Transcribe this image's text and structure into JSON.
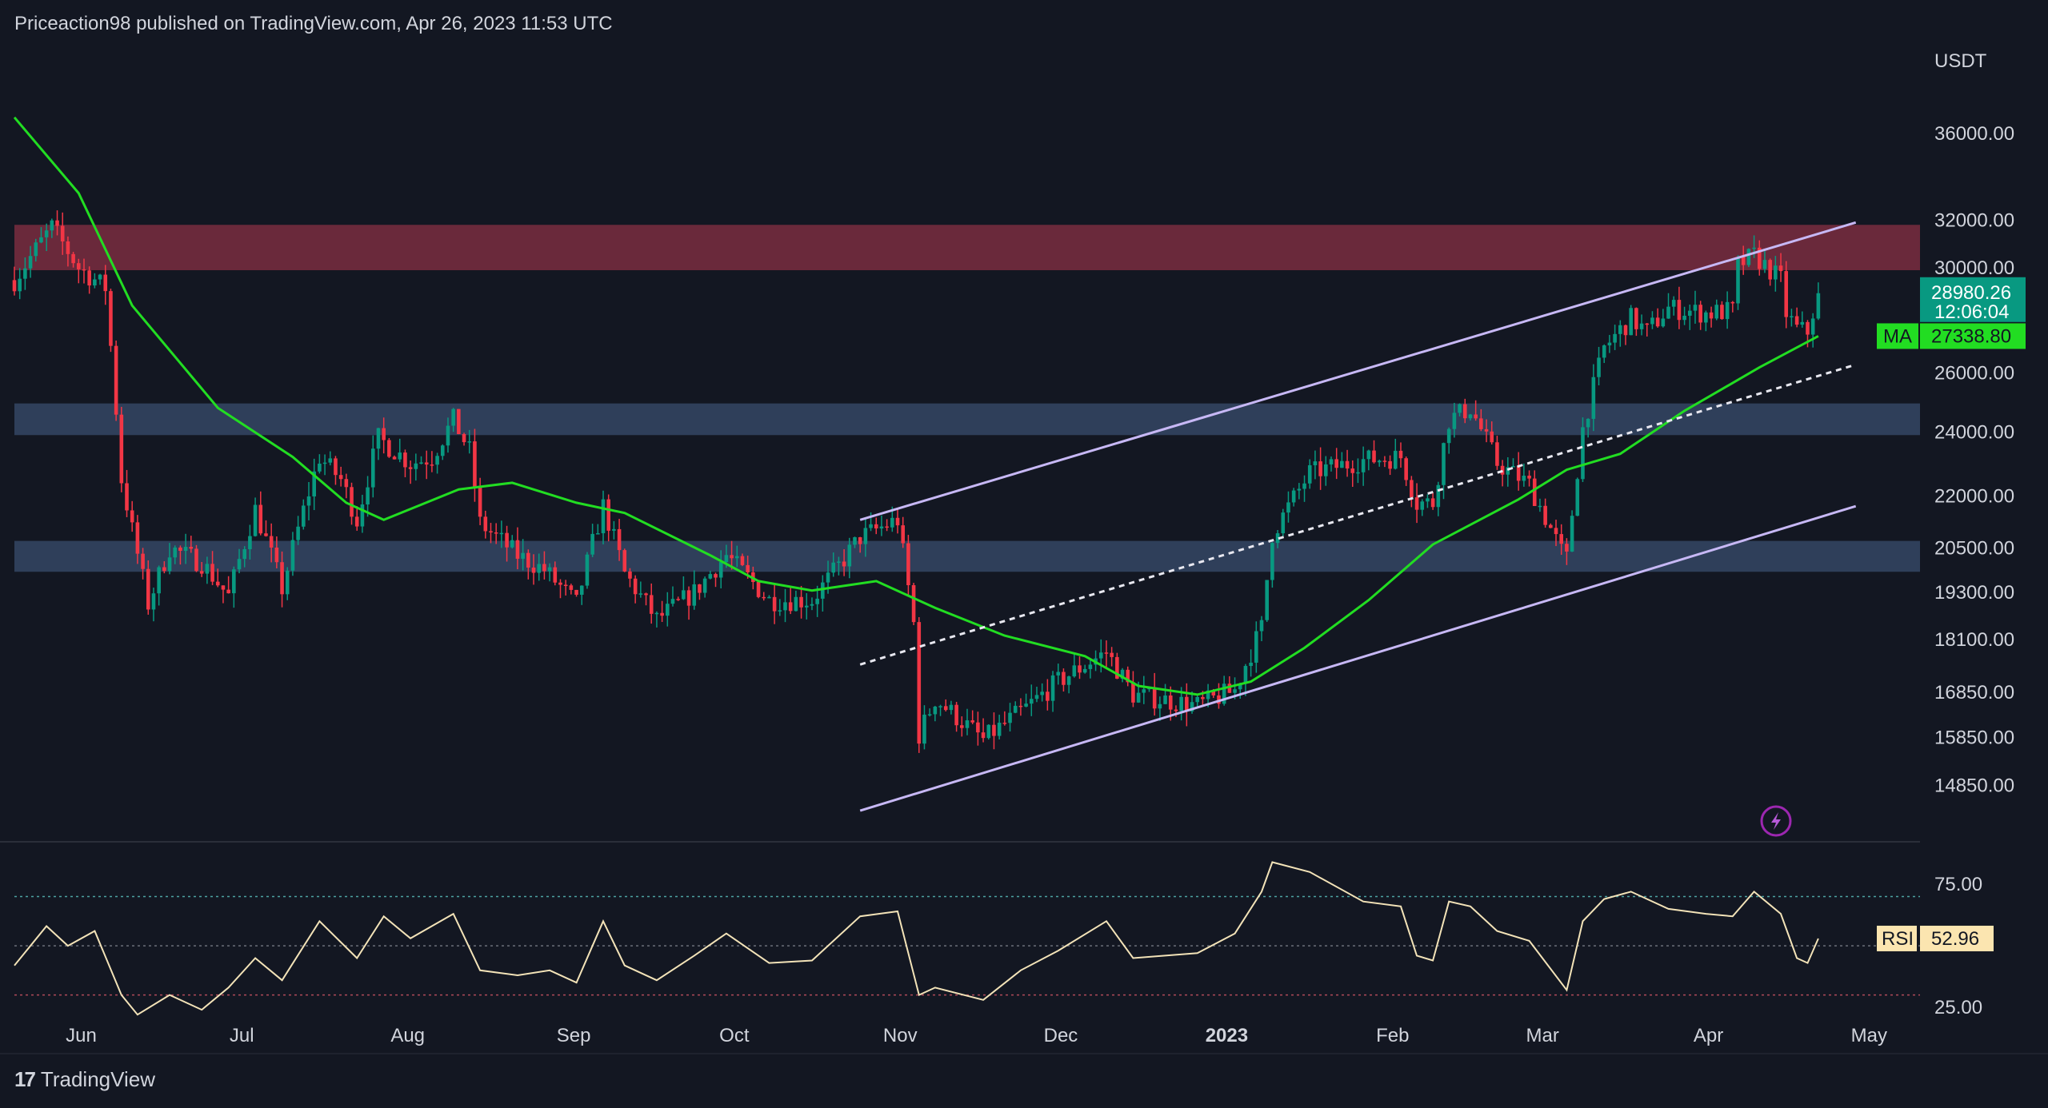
{
  "header": {
    "published_line": "Priceaction98 published on TradingView.com, Apr 26, 2023 11:53 UTC"
  },
  "footer": {
    "brand": "TradingView"
  },
  "colors": {
    "background": "#131722",
    "bull": "#089981",
    "bear": "#f23645",
    "ma": "#22dd22",
    "channel": "#c7b8f5",
    "resistance_zone": "#7a2d40",
    "support_zone": "#3a4e6e",
    "rsi_line": "#f3e3b8",
    "price_tag": "#089981",
    "ma_tag": "#22dd22",
    "rsi_tag": "#fbe5b0"
  },
  "chart_data": [
    {
      "type": "candlestick",
      "currency": "USDT",
      "y_scale": "log",
      "ylim": [
        13800,
        40000
      ],
      "price_ticks": [
        36000,
        32000,
        30000,
        26000,
        24000,
        22000,
        20500,
        19300,
        18100,
        16850,
        15850,
        14850
      ],
      "price_tick_labels": [
        "36000.00",
        "32000.00",
        "30000.00",
        "26000.00",
        "24000.00",
        "22000.00",
        "20500.00",
        "19300.00",
        "18100.00",
        "16850.00",
        "15850.00",
        "14850.00"
      ],
      "x_labels": [
        "Jun",
        "Jul",
        "Aug",
        "Sep",
        "Oct",
        "Nov",
        "Dec",
        "2023",
        "Feb",
        "Mar",
        "Apr",
        "May"
      ],
      "x_label_dates": [
        "2022-06-01",
        "2022-07-01",
        "2022-08-01",
        "2022-09-01",
        "2022-10-01",
        "2022-11-01",
        "2022-12-01",
        "2023-01-01",
        "2023-02-01",
        "2023-03-01",
        "2023-04-01",
        "2023-05-01"
      ],
      "x_range": [
        "2022-05-24",
        "2023-05-15"
      ],
      "last_date": "2023-04-26",
      "price_path": [
        [
          "2022-05-24",
          29500
        ],
        [
          "2022-05-31",
          31700
        ],
        [
          "2022-06-05",
          30000
        ],
        [
          "2022-06-10",
          29200
        ],
        [
          "2022-06-13",
          22500
        ],
        [
          "2022-06-15",
          21000
        ],
        [
          "2022-06-18",
          19000
        ],
        [
          "2022-06-22",
          20500
        ],
        [
          "2022-06-28",
          20100
        ],
        [
          "2022-07-03",
          19200
        ],
        [
          "2022-07-08",
          21600
        ],
        [
          "2022-07-13",
          19400
        ],
        [
          "2022-07-20",
          23200
        ],
        [
          "2022-07-24",
          22500
        ],
        [
          "2022-07-27",
          21300
        ],
        [
          "2022-07-31",
          23800
        ],
        [
          "2022-08-06",
          23000
        ],
        [
          "2022-08-10",
          23200
        ],
        [
          "2022-08-14",
          24400
        ],
        [
          "2022-08-17",
          23400
        ],
        [
          "2022-08-19",
          21200
        ],
        [
          "2022-08-26",
          20300
        ],
        [
          "2022-08-31",
          19900
        ],
        [
          "2022-09-06",
          19000
        ],
        [
          "2022-09-11",
          21700
        ],
        [
          "2022-09-15",
          19800
        ],
        [
          "2022-09-21",
          18600
        ],
        [
          "2022-09-28",
          19300
        ],
        [
          "2022-10-04",
          20300
        ],
        [
          "2022-10-12",
          19100
        ],
        [
          "2022-10-20",
          19100
        ],
        [
          "2022-10-25",
          20000
        ],
        [
          "2022-10-29",
          20800
        ],
        [
          "2022-11-05",
          21300
        ],
        [
          "2022-11-08",
          18500
        ],
        [
          "2022-11-09",
          15900
        ],
        [
          "2022-11-12",
          16700
        ],
        [
          "2022-11-21",
          15800
        ],
        [
          "2022-11-29",
          16500
        ],
        [
          "2022-12-05",
          17100
        ],
        [
          "2022-12-14",
          17800
        ],
        [
          "2022-12-19",
          16800
        ],
        [
          "2022-12-31",
          16550
        ],
        [
          "2023-01-07",
          16900
        ],
        [
          "2023-01-12",
          18400
        ],
        [
          "2023-01-14",
          20900
        ],
        [
          "2023-01-21",
          22700
        ],
        [
          "2023-01-31",
          23100
        ],
        [
          "2023-02-07",
          23200
        ],
        [
          "2023-02-10",
          21800
        ],
        [
          "2023-02-13",
          21800
        ],
        [
          "2023-02-16",
          24400
        ],
        [
          "2023-02-20",
          24800
        ],
        [
          "2023-02-25",
          23000
        ],
        [
          "2023-03-03",
          22350
        ],
        [
          "2023-03-09",
          20400
        ],
        [
          "2023-03-10",
          20200
        ],
        [
          "2023-03-13",
          24100
        ],
        [
          "2023-03-17",
          26900
        ],
        [
          "2023-03-22",
          28000
        ],
        [
          "2023-03-25",
          27500
        ],
        [
          "2023-03-29",
          28400
        ],
        [
          "2023-04-05",
          28200
        ],
        [
          "2023-04-10",
          28300
        ],
        [
          "2023-04-11",
          30100
        ],
        [
          "2023-04-14",
          30500
        ],
        [
          "2023-04-19",
          29500
        ],
        [
          "2023-04-20",
          28200
        ],
        [
          "2023-04-22",
          27600
        ],
        [
          "2023-04-24",
          27500
        ],
        [
          "2023-04-26",
          28980.26
        ]
      ],
      "moving_average": {
        "label": "MA",
        "value": 27338.8,
        "value_label": "27338.80",
        "path": [
          [
            "2022-05-24",
            36800
          ],
          [
            "2022-06-05",
            33200
          ],
          [
            "2022-06-15",
            28500
          ],
          [
            "2022-07-01",
            24800
          ],
          [
            "2022-07-15",
            23200
          ],
          [
            "2022-07-25",
            21800
          ],
          [
            "2022-08-01",
            21300
          ],
          [
            "2022-08-15",
            22200
          ],
          [
            "2022-08-25",
            22400
          ],
          [
            "2022-09-06",
            21800
          ],
          [
            "2022-09-15",
            21500
          ],
          [
            "2022-10-01",
            20300
          ],
          [
            "2022-10-10",
            19600
          ],
          [
            "2022-10-20",
            19350
          ],
          [
            "2022-11-01",
            19600
          ],
          [
            "2022-11-12",
            18900
          ],
          [
            "2022-11-25",
            18200
          ],
          [
            "2022-12-10",
            17700
          ],
          [
            "2022-12-20",
            17000
          ],
          [
            "2022-12-31",
            16800
          ],
          [
            "2023-01-10",
            17100
          ],
          [
            "2023-01-20",
            17900
          ],
          [
            "2023-02-01",
            19100
          ],
          [
            "2023-02-13",
            20600
          ],
          [
            "2023-03-01",
            21900
          ],
          [
            "2023-03-10",
            22800
          ],
          [
            "2023-03-20",
            23300
          ],
          [
            "2023-04-01",
            24700
          ],
          [
            "2023-04-15",
            26200
          ],
          [
            "2023-04-26",
            27340
          ]
        ]
      },
      "last_price": {
        "value": 28980.26,
        "label": "28980.26",
        "countdown": "12:06:04"
      },
      "zones": [
        {
          "name": "resistance",
          "from": 29900,
          "to": 31800
        },
        {
          "name": "support-upper",
          "from": 23900,
          "to": 24950
        },
        {
          "name": "support-lower",
          "from": 19850,
          "to": 20700
        }
      ],
      "channel_lines": [
        {
          "name": "channel-upper",
          "style": "solid",
          "points": [
            [
              "2022-10-29",
              21300
            ],
            [
              "2023-05-03",
              31900
            ]
          ]
        },
        {
          "name": "channel-mid",
          "style": "dashed",
          "points": [
            [
              "2022-10-29",
              17500
            ],
            [
              "2023-05-03",
              26300
            ]
          ]
        },
        {
          "name": "channel-lower",
          "style": "solid",
          "points": [
            [
              "2022-10-29",
              14350
            ],
            [
              "2023-05-03",
              21700
            ]
          ]
        }
      ]
    },
    {
      "type": "line",
      "indicator": "RSI",
      "value": 52.96,
      "value_label": "52.96",
      "ylim": [
        12,
        90
      ],
      "ticks": [
        75,
        25
      ],
      "tick_labels": [
        "75.00",
        "25.00"
      ],
      "bands": [
        70,
        50,
        30
      ],
      "path": [
        [
          "2022-05-24",
          42
        ],
        [
          "2022-05-30",
          58
        ],
        [
          "2022-06-03",
          50
        ],
        [
          "2022-06-08",
          56
        ],
        [
          "2022-06-13",
          30
        ],
        [
          "2022-06-16",
          22
        ],
        [
          "2022-06-22",
          30
        ],
        [
          "2022-06-28",
          24
        ],
        [
          "2022-07-03",
          33
        ],
        [
          "2022-07-08",
          45
        ],
        [
          "2022-07-13",
          36
        ],
        [
          "2022-07-20",
          60
        ],
        [
          "2022-07-27",
          45
        ],
        [
          "2022-08-01",
          62
        ],
        [
          "2022-08-06",
          53
        ],
        [
          "2022-08-14",
          63
        ],
        [
          "2022-08-19",
          40
        ],
        [
          "2022-08-26",
          38
        ],
        [
          "2022-09-01",
          40
        ],
        [
          "2022-09-06",
          35
        ],
        [
          "2022-09-11",
          60
        ],
        [
          "2022-09-15",
          42
        ],
        [
          "2022-09-21",
          36
        ],
        [
          "2022-09-28",
          46
        ],
        [
          "2022-10-04",
          55
        ],
        [
          "2022-10-12",
          43
        ],
        [
          "2022-10-20",
          44
        ],
        [
          "2022-10-29",
          62
        ],
        [
          "2022-11-05",
          64
        ],
        [
          "2022-11-09",
          30
        ],
        [
          "2022-11-12",
          33
        ],
        [
          "2022-11-21",
          28
        ],
        [
          "2022-11-28",
          40
        ],
        [
          "2022-12-05",
          48
        ],
        [
          "2022-12-14",
          60
        ],
        [
          "2022-12-19",
          45
        ],
        [
          "2022-12-31",
          47
        ],
        [
          "2023-01-07",
          55
        ],
        [
          "2023-01-12",
          72
        ],
        [
          "2023-01-14",
          84
        ],
        [
          "2023-01-21",
          80
        ],
        [
          "2023-01-31",
          68
        ],
        [
          "2023-02-07",
          66
        ],
        [
          "2023-02-10",
          46
        ],
        [
          "2023-02-13",
          44
        ],
        [
          "2023-02-16",
          68
        ],
        [
          "2023-02-20",
          66
        ],
        [
          "2023-02-25",
          56
        ],
        [
          "2023-03-03",
          52
        ],
        [
          "2023-03-10",
          32
        ],
        [
          "2023-03-13",
          60
        ],
        [
          "2023-03-17",
          69
        ],
        [
          "2023-03-22",
          72
        ],
        [
          "2023-03-29",
          65
        ],
        [
          "2023-04-05",
          63
        ],
        [
          "2023-04-10",
          62
        ],
        [
          "2023-04-14",
          72
        ],
        [
          "2023-04-19",
          63
        ],
        [
          "2023-04-22",
          45
        ],
        [
          "2023-04-24",
          43
        ],
        [
          "2023-04-26",
          52.96
        ]
      ]
    }
  ]
}
